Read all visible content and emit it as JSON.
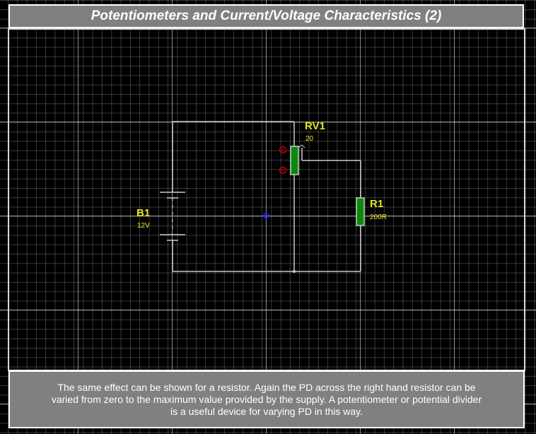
{
  "title": "Potentiometers and Current/Voltage Characteristics (2)",
  "description_lines": [
    "The same effect can be shown for a resistor.  Again the PD across the right hand resistor can be",
    "varied from zero to the maximum value provided by the supply.  A potentiometer or potential divider",
    "is a useful device for varying PD in this way."
  ],
  "components": {
    "battery": {
      "ref": "B1",
      "value": "12V"
    },
    "potentiometer": {
      "ref": "RV1",
      "value": "20"
    },
    "resistor": {
      "ref": "R1",
      "value": "200R"
    }
  },
  "colors": {
    "label": "#e8e820",
    "component_fill": "#0a8a0a",
    "wire": "#c8c8c8",
    "pin_marker": "#e00000"
  }
}
